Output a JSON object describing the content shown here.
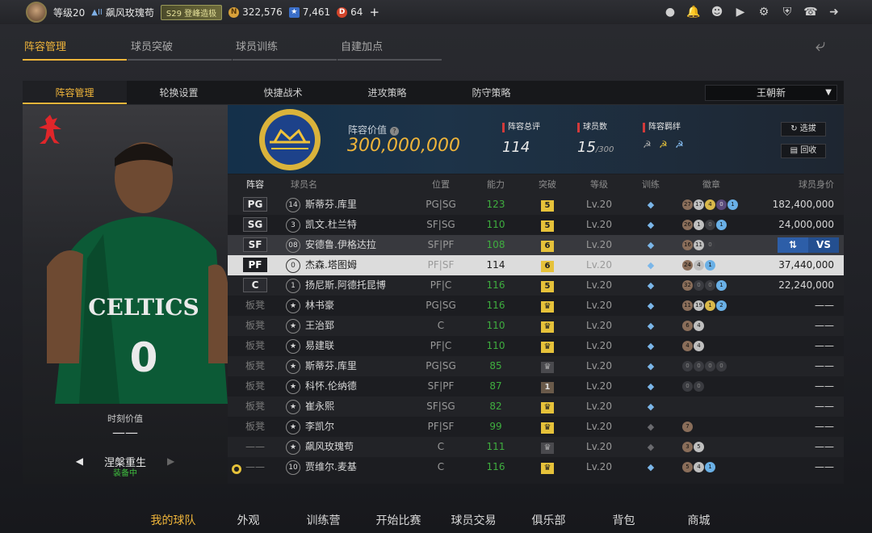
{
  "topbar": {
    "level": "等级20",
    "rank_badge": "II",
    "username": "飙风玫瑰苟",
    "season_badge": "S29 登峰造极",
    "coins": "322,576",
    "stars": "7,461",
    "tokens": "64",
    "plus": "+",
    "icons": [
      "profile-icon",
      "bell-icon",
      "friends-icon",
      "video-icon",
      "settings-icon",
      "shield-icon",
      "support-icon",
      "logout-icon"
    ]
  },
  "subnav": {
    "tabs": [
      "阵容管理",
      "球员突破",
      "球员训练",
      "自建加点"
    ],
    "active": 0
  },
  "innertabs": {
    "tabs": [
      "阵容管理",
      "轮换设置",
      "快捷战术",
      "进攻策略",
      "防守策略"
    ],
    "active": 0,
    "selector": "王朝新"
  },
  "portrait": {
    "moment_label": "时刻价值",
    "moment_value": "——",
    "card_name": "涅槃重生",
    "card_status": "装备中"
  },
  "header": {
    "lineup_value_label": "阵容价值",
    "lineup_value": "300,000,000",
    "stats": [
      {
        "label": "阵容总评",
        "value": "114",
        "sub": ""
      },
      {
        "label": "球员数",
        "value": "15",
        "sub": "/300"
      },
      {
        "label": "阵容羁绊",
        "value": "",
        "sub": ""
      }
    ],
    "buttons": [
      "选拔",
      "回收"
    ]
  },
  "table": {
    "headers": [
      "阵容",
      "球员名",
      "位置",
      "能力",
      "突破",
      "等级",
      "训练",
      "徽章",
      "球员身价"
    ],
    "rows": [
      {
        "slot": "PG",
        "type": "starter",
        "icon": "14",
        "name": "斯蒂芬.库里",
        "pos": "PG|SG",
        "ovr": "123",
        "brk": "5",
        "lvl": "Lv.20",
        "val": "182,400,000",
        "badges": [
          [
            "br",
            "27"
          ],
          [
            "sv",
            "17"
          ],
          [
            "gd",
            "4"
          ],
          [
            "hf",
            "0"
          ],
          [
            "pk",
            "1"
          ]
        ]
      },
      {
        "slot": "SG",
        "type": "starter",
        "icon": "3",
        "name": "凯文.杜兰特",
        "pos": "SF|SG",
        "ovr": "110",
        "brk": "5",
        "lvl": "Lv.20",
        "val": "24,000,000",
        "badges": [
          [
            "br",
            "26"
          ],
          [
            "sv",
            "1"
          ],
          [
            "em",
            "0"
          ],
          [
            "pk",
            "1"
          ]
        ]
      },
      {
        "slot": "SF",
        "type": "starter",
        "icon": "08",
        "name": "安德鲁.伊格达拉",
        "pos": "SF|PF",
        "ovr": "108",
        "brk": "6",
        "lvl": "Lv.20",
        "val": "",
        "badges": [
          [
            "br",
            "16"
          ],
          [
            "sv",
            "11"
          ],
          [
            "em",
            "0"
          ]
        ]
      },
      {
        "slot": "PF",
        "type": "starter",
        "icon": "0",
        "name": "杰森.塔图姆",
        "pos": "PF|SF",
        "ovr": "114",
        "brk": "6",
        "lvl": "Lv.20",
        "val": "37,440,000",
        "badges": [
          [
            "br",
            "24"
          ],
          [
            "sv",
            "4"
          ],
          [
            "pk",
            "1"
          ]
        ]
      },
      {
        "slot": "C",
        "type": "starter",
        "icon": "1",
        "name": "扬尼斯.阿德托昆博",
        "pos": "PF|C",
        "ovr": "116",
        "brk": "5",
        "lvl": "Lv.20",
        "val": "22,240,000",
        "badges": [
          [
            "br",
            "32"
          ],
          [
            "em",
            "0"
          ],
          [
            "em",
            "0"
          ],
          [
            "pk",
            "1"
          ]
        ]
      },
      {
        "slot": "板凳",
        "type": "bench",
        "icon": "",
        "name": "林书豪",
        "pos": "PG|SG",
        "ovr": "116",
        "brk": "",
        "lvl": "Lv.20",
        "val": "——",
        "badges": [
          [
            "br",
            "11"
          ],
          [
            "sv",
            "19"
          ],
          [
            "gd",
            "1"
          ],
          [
            "pk",
            "2"
          ]
        ]
      },
      {
        "slot": "板凳",
        "type": "bench",
        "icon": "",
        "name": "王治郅",
        "pos": "C",
        "ovr": "110",
        "brk": "",
        "lvl": "Lv.20",
        "val": "——",
        "badges": [
          [
            "br",
            "6"
          ],
          [
            "sv",
            "4"
          ]
        ]
      },
      {
        "slot": "板凳",
        "type": "bench",
        "icon": "",
        "name": "易建联",
        "pos": "PF|C",
        "ovr": "110",
        "brk": "",
        "lvl": "Lv.20",
        "val": "——",
        "badges": [
          [
            "br",
            "4"
          ],
          [
            "sv",
            "4"
          ]
        ]
      },
      {
        "slot": "板凳",
        "type": "bench",
        "icon": "",
        "name": "斯蒂芬.库里",
        "pos": "PG|SG",
        "ovr": "85",
        "brk": "",
        "lvl": "Lv.20",
        "val": "——",
        "badges": [
          [
            "em",
            "0"
          ],
          [
            "em",
            "0"
          ],
          [
            "em",
            "0"
          ],
          [
            "em",
            "0"
          ]
        ]
      },
      {
        "slot": "板凳",
        "type": "bench",
        "icon": "",
        "name": "科怀.伦纳德",
        "pos": "SF|PF",
        "ovr": "87",
        "brk": "1",
        "lvl": "Lv.20",
        "val": "——",
        "badges": [
          [
            "em",
            "0"
          ],
          [
            "em",
            "0"
          ]
        ]
      },
      {
        "slot": "板凳",
        "type": "bench",
        "icon": "",
        "name": "崔永熙",
        "pos": "SF|SG",
        "ovr": "82",
        "brk": "",
        "lvl": "Lv.20",
        "val": "——",
        "badges": []
      },
      {
        "slot": "板凳",
        "type": "bench",
        "icon": "",
        "name": "李凯尔",
        "pos": "PF|SF",
        "ovr": "99",
        "brk": "",
        "lvl": "Lv.20",
        "val": "——",
        "badges": [
          [
            "br",
            "7"
          ]
        ]
      },
      {
        "slot": "——",
        "type": "reserve",
        "icon": "",
        "name": "飙风玫瑰苟",
        "pos": "C",
        "ovr": "111",
        "brk": "",
        "lvl": "Lv.20",
        "val": "——",
        "badges": [
          [
            "br",
            "3"
          ],
          [
            "sv",
            "5"
          ]
        ]
      },
      {
        "slot": "——",
        "type": "reserve",
        "icon": "10",
        "name": "贾维尔.麦基",
        "pos": "C",
        "ovr": "116",
        "brk": "",
        "lvl": "Lv.20",
        "val": "——",
        "badges": [
          [
            "br",
            "5"
          ],
          [
            "sv",
            "4"
          ],
          [
            "pk",
            "1"
          ]
        ]
      }
    ],
    "swap_label": "VS"
  },
  "bottomnav": {
    "items": [
      "我的球队",
      "外观",
      "训练营",
      "开始比赛",
      "球员交易",
      "俱乐部",
      "背包",
      "商城"
    ],
    "active": 0
  },
  "colors": {
    "accent": "#f0b53a",
    "green_ovr": "#3fae3f",
    "status_red": "#d23a3a",
    "swap_blue": "#2d5ea8"
  }
}
